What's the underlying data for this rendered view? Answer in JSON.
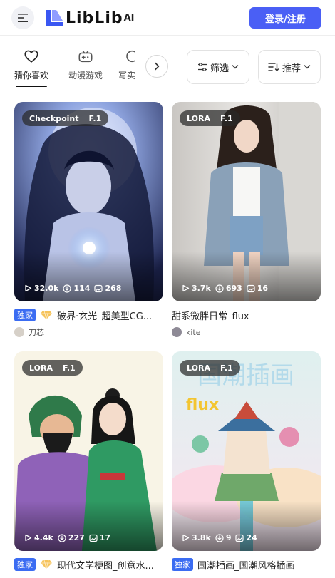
{
  "header": {
    "logo_text": "LibLib",
    "logo_sup": "AI",
    "login_label": "登录/注册"
  },
  "categories": [
    {
      "label": "猜你喜欢",
      "icon": "heart-icon",
      "active": true
    },
    {
      "label": "动漫游戏",
      "icon": "gamepad-icon",
      "active": false
    },
    {
      "label": "写实",
      "icon": "partial-icon",
      "active": false
    }
  ],
  "filters": {
    "filter_label": "筛选",
    "sort_label": "推荐"
  },
  "cards": [
    {
      "tag1": "Checkpoint",
      "tag2": "F.1",
      "views": "32.0k",
      "downloads": "114",
      "images": "268",
      "exclusive": "独家",
      "premium": true,
      "title": "破界·玄光_超美型CG...",
      "author": "刀芯"
    },
    {
      "tag1": "LORA",
      "tag2": "F.1",
      "views": "3.7k",
      "downloads": "693",
      "images": "16",
      "exclusive": "",
      "premium": false,
      "title": "甜系微胖日常_flux",
      "author": "kite"
    },
    {
      "tag1": "LORA",
      "tag2": "F.1",
      "views": "4.4k",
      "downloads": "227",
      "images": "17",
      "exclusive": "独家",
      "premium": true,
      "title": "现代文学梗图_创意水...",
      "author": ""
    },
    {
      "tag1": "LORA",
      "tag2": "F.1",
      "views": "3.8k",
      "downloads": "9",
      "images": "24",
      "exclusive": "独家",
      "premium": false,
      "title": "国潮插画_国潮风格插画",
      "author": ""
    }
  ],
  "colors": {
    "accent": "#4a5ff5",
    "exclusive_badge": "#3b6cf2"
  }
}
